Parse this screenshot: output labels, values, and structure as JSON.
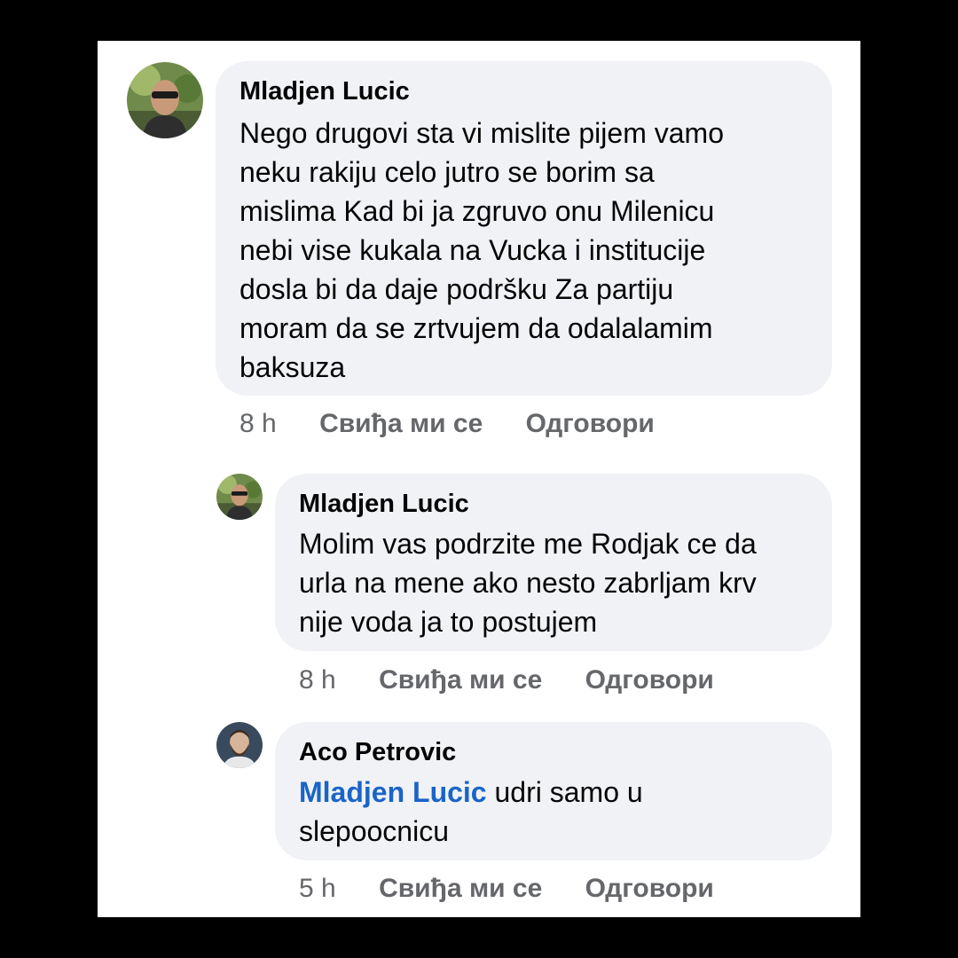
{
  "comments": [
    {
      "author": "Mladjen Lucic",
      "text_lines": [
        "Nego drugovi sta vi mislite pijem vamo",
        "neku rakiju celo jutro se borim sa",
        "mislima Kad bi ja zgruvo onu Milenicu",
        "nebi vise kukala na Vucka i institucije",
        "dosla bi da daje podršku Za partiju",
        "moram da se zrtvujem da odalalamim",
        "baksuza"
      ],
      "time": "8 h",
      "like_label": "Свиђа ми се",
      "reply_label": "Одговори",
      "avatar_icon": "profile-photo-man-sunglasses"
    },
    {
      "author": "Mladjen Lucic",
      "text_lines": [
        "Molim vas podrzite me Rodjak ce da",
        "urla na mene ako nesto zabrljam krv",
        "nije voda ja to postujem"
      ],
      "time": "8 h",
      "like_label": "Свиђа ми се",
      "reply_label": "Одговори",
      "avatar_icon": "profile-photo-man-sunglasses"
    },
    {
      "author": "Aco Petrovic",
      "mention": "Mladjen Lucic",
      "text_after_mention": " udri samo u",
      "text_line_2": "slepoocnicu",
      "time": "5 h",
      "like_label": "Свиђа ми се",
      "reply_label": "Одговори",
      "avatar_icon": "profile-photo-bearded-man"
    }
  ],
  "colors": {
    "bubble": "#f0f2f5",
    "text": "#050505",
    "meta": "#65676b",
    "mention": "#1a64c8",
    "border": "#000000"
  }
}
